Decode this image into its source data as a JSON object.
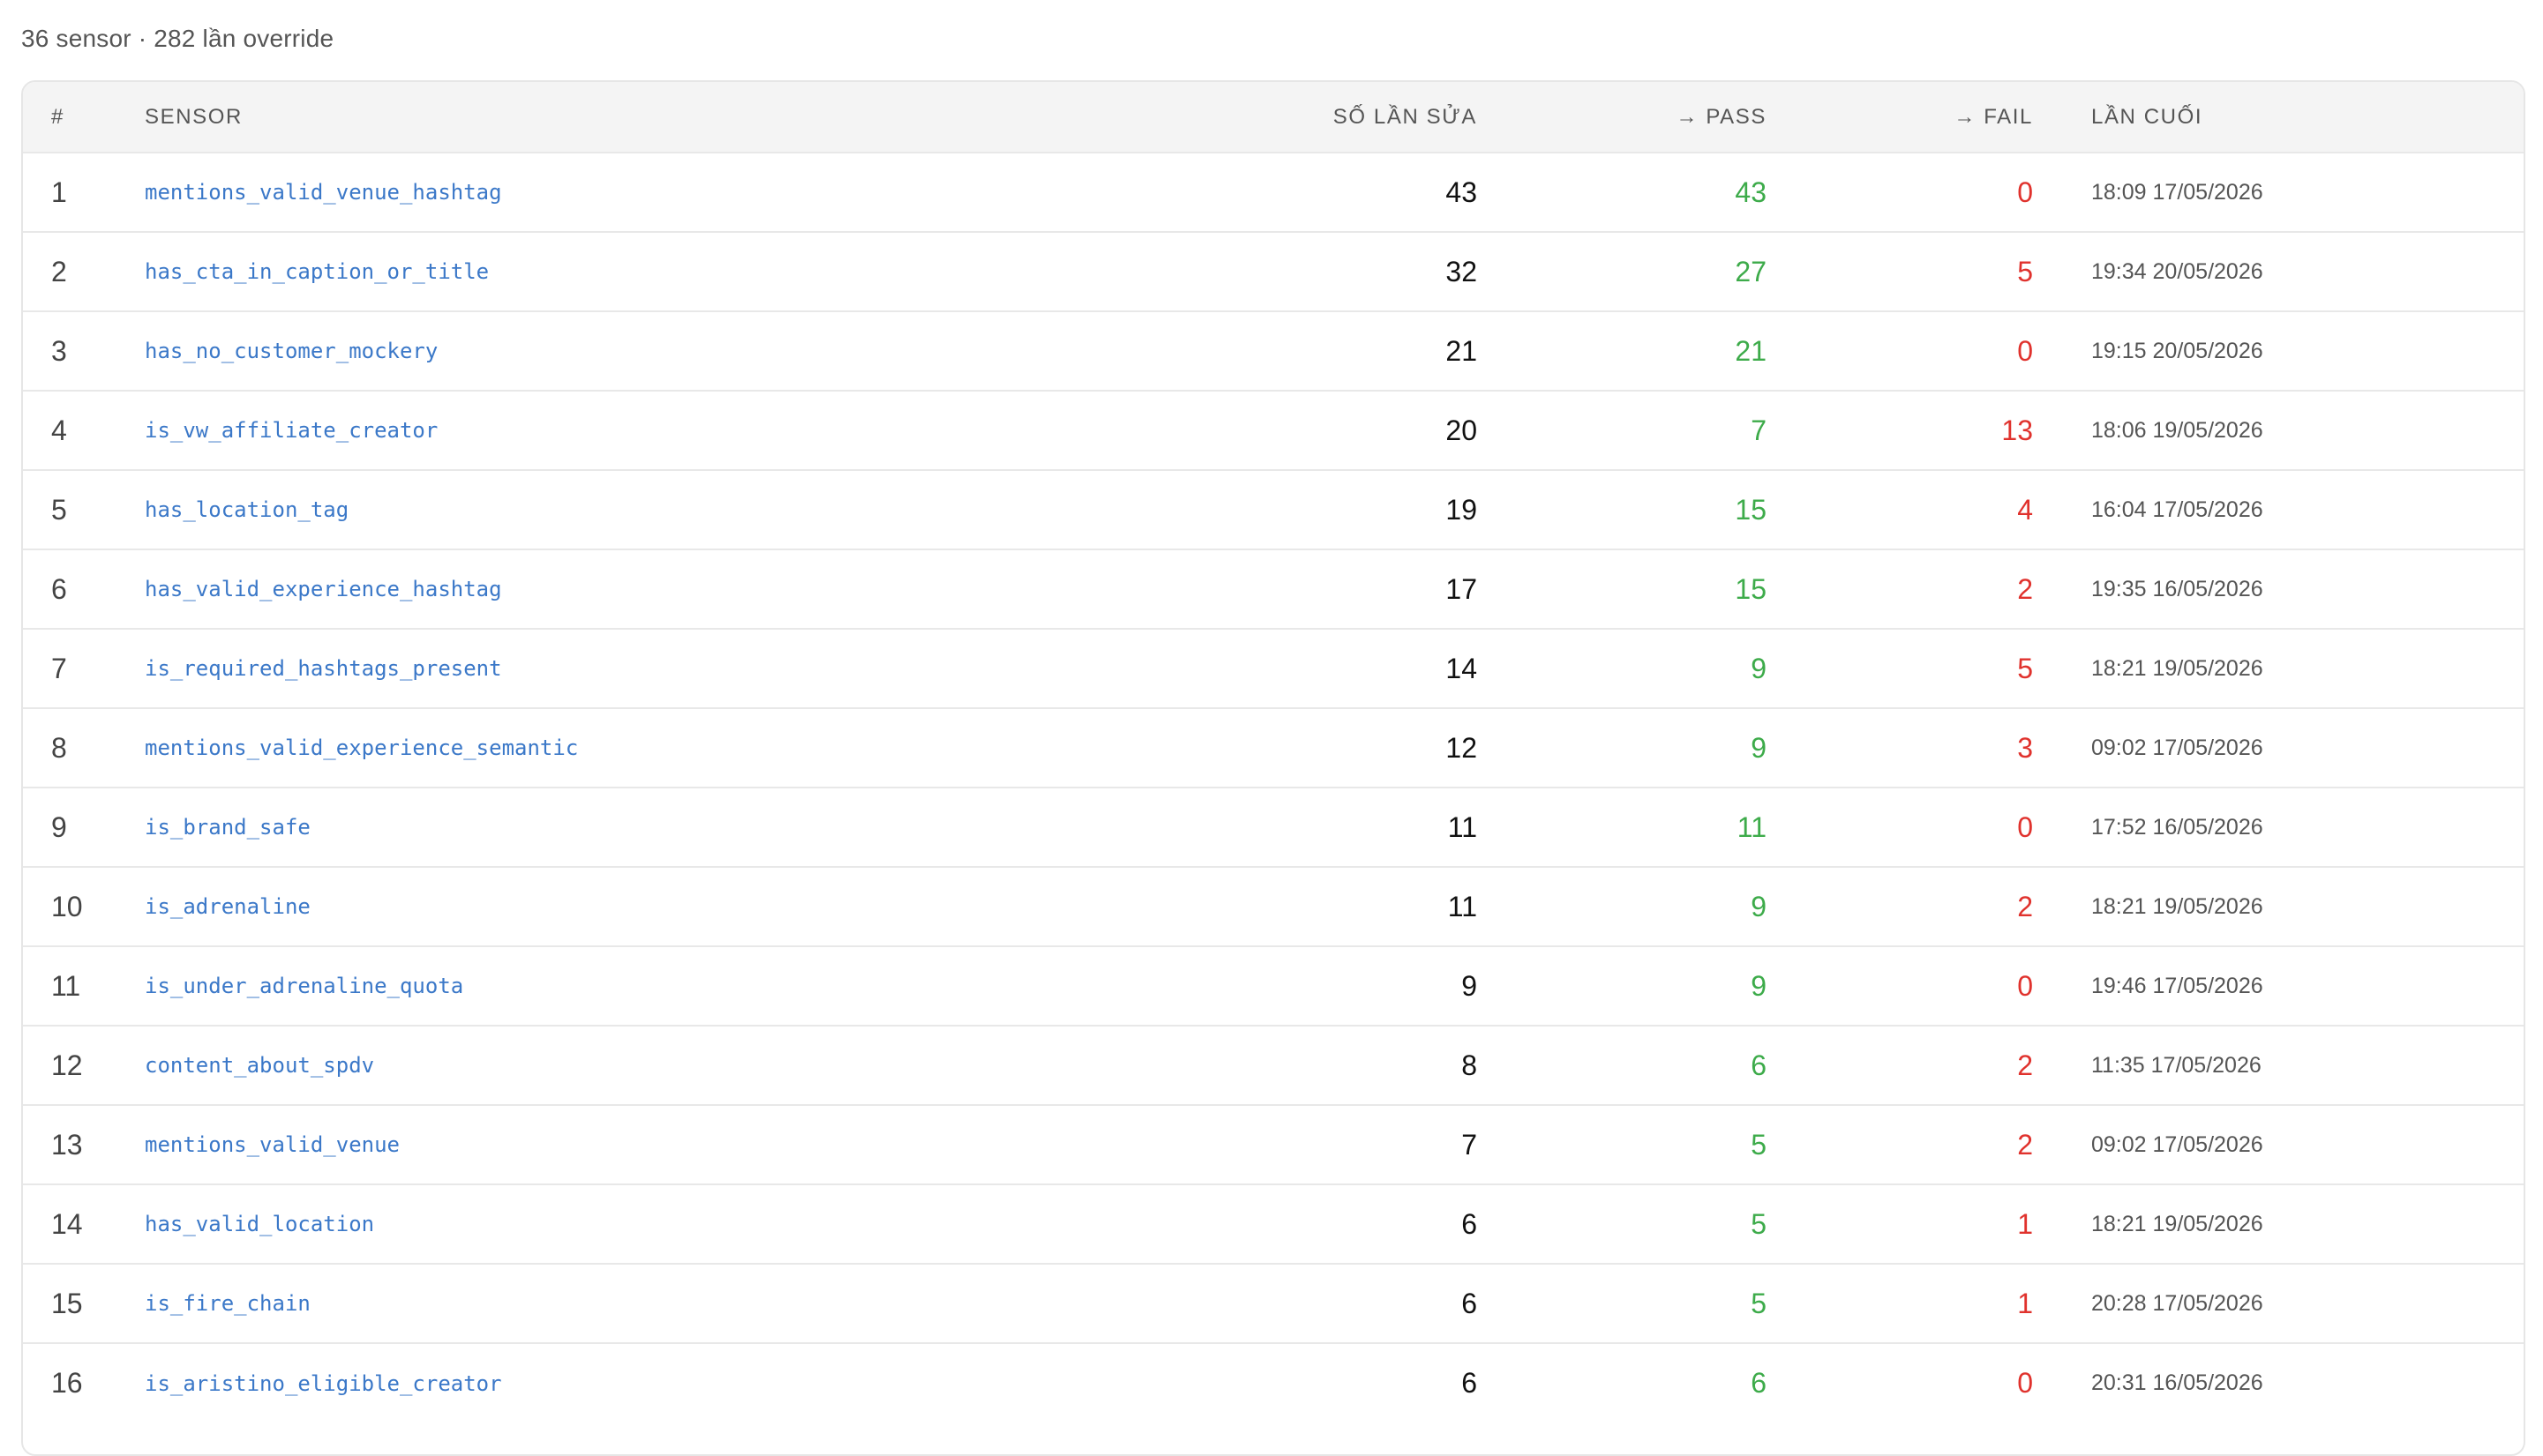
{
  "summary": "36 sensor · 282 lần override",
  "table": {
    "headers": {
      "index": "#",
      "sensor": "SENSOR",
      "count": "SỐ LẦN SỬA",
      "pass": "→ PASS",
      "fail": "→ FAIL",
      "last": "LẦN CUỐI"
    },
    "rows": [
      {
        "index": "1",
        "sensor": "mentions_valid_venue_hashtag",
        "count": "43",
        "pass": "43",
        "fail": "0",
        "last": "18:09 17/05/2026"
      },
      {
        "index": "2",
        "sensor": "has_cta_in_caption_or_title",
        "count": "32",
        "pass": "27",
        "fail": "5",
        "last": "19:34 20/05/2026"
      },
      {
        "index": "3",
        "sensor": "has_no_customer_mockery",
        "count": "21",
        "pass": "21",
        "fail": "0",
        "last": "19:15 20/05/2026"
      },
      {
        "index": "4",
        "sensor": "is_vw_affiliate_creator",
        "count": "20",
        "pass": "7",
        "fail": "13",
        "last": "18:06 19/05/2026"
      },
      {
        "index": "5",
        "sensor": "has_location_tag",
        "count": "19",
        "pass": "15",
        "fail": "4",
        "last": "16:04 17/05/2026"
      },
      {
        "index": "6",
        "sensor": "has_valid_experience_hashtag",
        "count": "17",
        "pass": "15",
        "fail": "2",
        "last": "19:35 16/05/2026"
      },
      {
        "index": "7",
        "sensor": "is_required_hashtags_present",
        "count": "14",
        "pass": "9",
        "fail": "5",
        "last": "18:21 19/05/2026"
      },
      {
        "index": "8",
        "sensor": "mentions_valid_experience_semantic",
        "count": "12",
        "pass": "9",
        "fail": "3",
        "last": "09:02 17/05/2026"
      },
      {
        "index": "9",
        "sensor": "is_brand_safe",
        "count": "11",
        "pass": "11",
        "fail": "0",
        "last": "17:52 16/05/2026"
      },
      {
        "index": "10",
        "sensor": "is_adrenaline",
        "count": "11",
        "pass": "9",
        "fail": "2",
        "last": "18:21 19/05/2026"
      },
      {
        "index": "11",
        "sensor": "is_under_adrenaline_quota",
        "count": "9",
        "pass": "9",
        "fail": "0",
        "last": "19:46 17/05/2026"
      },
      {
        "index": "12",
        "sensor": "content_about_spdv",
        "count": "8",
        "pass": "6",
        "fail": "2",
        "last": "11:35 17/05/2026"
      },
      {
        "index": "13",
        "sensor": "mentions_valid_venue",
        "count": "7",
        "pass": "5",
        "fail": "2",
        "last": "09:02 17/05/2026"
      },
      {
        "index": "14",
        "sensor": "has_valid_location",
        "count": "6",
        "pass": "5",
        "fail": "1",
        "last": "18:21 19/05/2026"
      },
      {
        "index": "15",
        "sensor": "is_fire_chain",
        "count": "6",
        "pass": "5",
        "fail": "1",
        "last": "20:28 17/05/2026"
      },
      {
        "index": "16",
        "sensor": "is_aristino_eligible_creator",
        "count": "6",
        "pass": "6",
        "fail": "0",
        "last": "20:31 16/05/2026"
      }
    ]
  },
  "colors": {
    "link": "#3b78c8",
    "pass": "#3dab4a",
    "fail": "#e0322d"
  }
}
